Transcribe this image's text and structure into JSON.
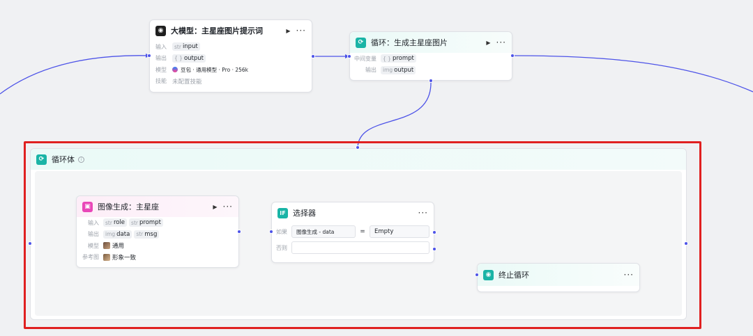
{
  "llm_node": {
    "title": "大模型：主星座图片提示词",
    "input_label": "输入",
    "input_type": "str",
    "input_value": "input",
    "output_label": "输出",
    "output_type": "{ }",
    "output_value": "output",
    "model_label": "模型",
    "model_value": "豆包 · 通用模型 · Pro · 256k",
    "skill_label": "技能",
    "skill_value": "未配置技能",
    "play_icon": "play-icon",
    "more_icon": "more-icon"
  },
  "loop_node": {
    "title": "循环：生成主星座图片",
    "var_label": "中间变量",
    "var_type": "{ }",
    "var_value": "prompt",
    "output_label": "输出",
    "output_type": "img",
    "output_value": "output"
  },
  "loop_body": {
    "title": "循环体",
    "info_icon": "i"
  },
  "image_node": {
    "title": "图像生成：主星座",
    "input_label": "输入",
    "input_tags": [
      {
        "type": "str",
        "value": "role"
      },
      {
        "type": "str",
        "value": "prompt"
      }
    ],
    "output_label": "输出",
    "output_tags": [
      {
        "type": "img",
        "value": "data"
      },
      {
        "type": "str",
        "value": "msg"
      }
    ],
    "model_label": "模型",
    "model_value": "通用",
    "ref_label": "参考图",
    "ref_value": "形象一致"
  },
  "selector_node": {
    "title": "选择器",
    "icon_text": "IF",
    "if_label": "如果",
    "cond_left": "图像生成 - data",
    "cond_op": "=",
    "cond_right": "Empty",
    "else_label": "否则"
  },
  "break_node": {
    "title": "终止循环"
  },
  "colors": {
    "wire": "#4d53e8",
    "highlight": "#e02020",
    "loop_accent": "#19b4a6",
    "image_accent": "#e947b8"
  }
}
